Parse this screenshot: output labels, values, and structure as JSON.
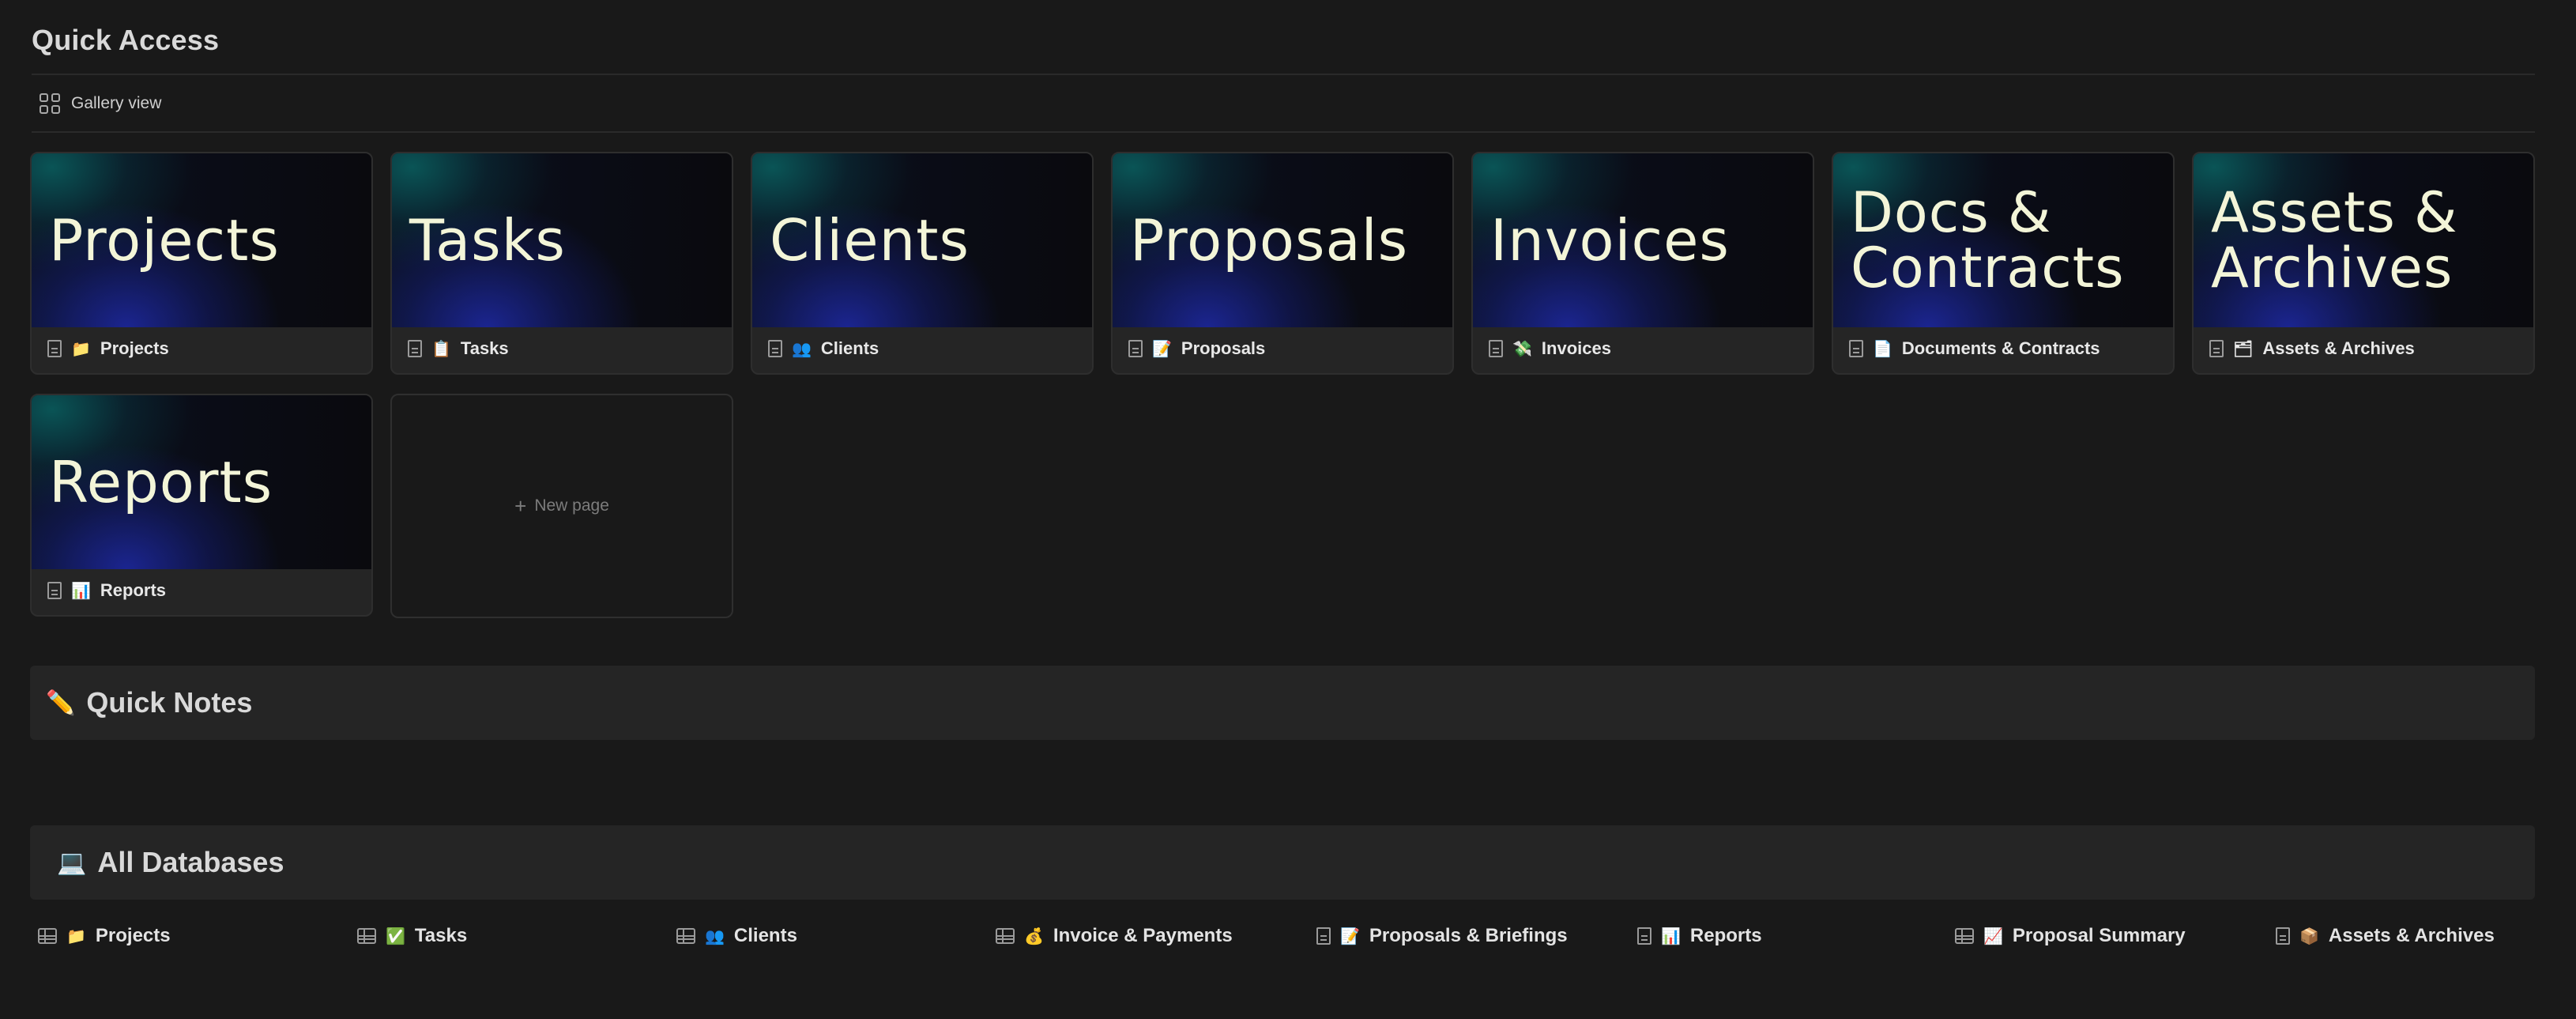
{
  "quick_access": {
    "title": "Quick Access",
    "view_label": "Gallery view",
    "cards": [
      {
        "cover": "Projects",
        "emoji": "📁",
        "label": "Projects"
      },
      {
        "cover": "Tasks",
        "emoji": "📋",
        "label": "Tasks"
      },
      {
        "cover": "Clients",
        "emoji": "👥",
        "label": "Clients"
      },
      {
        "cover": "Proposals",
        "emoji": "📝",
        "label": "Proposals"
      },
      {
        "cover": "Invoices",
        "emoji": "💸",
        "label": "Invoices"
      },
      {
        "cover": "Docs & Contracts",
        "emoji": "📄",
        "label": "Documents & Contracts"
      },
      {
        "cover": "Assets & Archives",
        "emoji": "🗂",
        "label": "Assets & Archives"
      },
      {
        "cover": "Reports",
        "emoji": "📊",
        "label": "Reports"
      }
    ],
    "new_page_label": "New page"
  },
  "quick_notes": {
    "icon": "✏️",
    "title": "Quick Notes"
  },
  "all_databases": {
    "icon": "💻",
    "title": "All Databases",
    "items": [
      {
        "icon_type": "table",
        "emoji": "📁",
        "label": "Projects"
      },
      {
        "icon_type": "table",
        "emoji": "✅",
        "label": "Tasks"
      },
      {
        "icon_type": "table",
        "emoji": "👥",
        "label": "Clients"
      },
      {
        "icon_type": "table",
        "emoji": "💰",
        "label": "Invoice & Payments"
      },
      {
        "icon_type": "page",
        "emoji": "📝",
        "label": "Proposals & Briefings"
      },
      {
        "icon_type": "page",
        "emoji": "📊",
        "label": "Reports"
      },
      {
        "icon_type": "table",
        "emoji": "📈",
        "label": "Proposal Summary"
      },
      {
        "icon_type": "page",
        "emoji": "📦",
        "label": "Assets & Archives"
      }
    ]
  }
}
